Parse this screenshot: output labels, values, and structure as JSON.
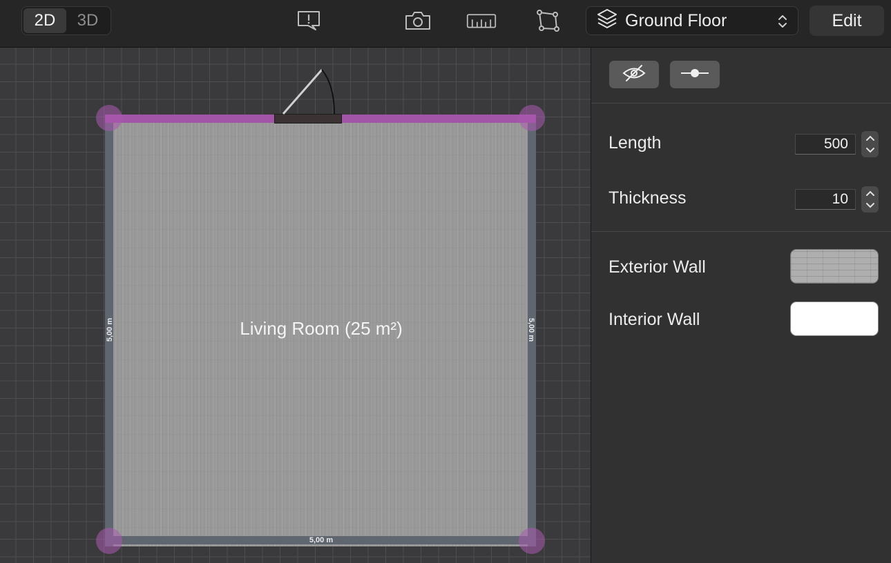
{
  "toolbar": {
    "view_modes": [
      "2D",
      "3D"
    ],
    "active_view": "2D",
    "icons": [
      "feedback-icon",
      "camera-icon",
      "ruler-icon",
      "polygon-icon"
    ],
    "floor_selector": {
      "icon": "layers-icon",
      "label": "Ground Floor"
    },
    "edit_label": "Edit"
  },
  "canvas": {
    "room_label": "Living Room (25 m²)",
    "dimensions": {
      "bottom": "5,00 m",
      "left": "5,00 m",
      "right": "5,00 m"
    },
    "selected_wall_color": "#a255a6",
    "wall_color": "#5f6670"
  },
  "inspector": {
    "buttons": [
      "hide-icon",
      "split-icon"
    ],
    "length": {
      "label": "Length",
      "value": "500"
    },
    "thickness": {
      "label": "Thickness",
      "value": "10"
    },
    "exterior_wall": {
      "label": "Exterior Wall"
    },
    "interior_wall": {
      "label": "Interior Wall",
      "color": "#ffffff"
    }
  }
}
